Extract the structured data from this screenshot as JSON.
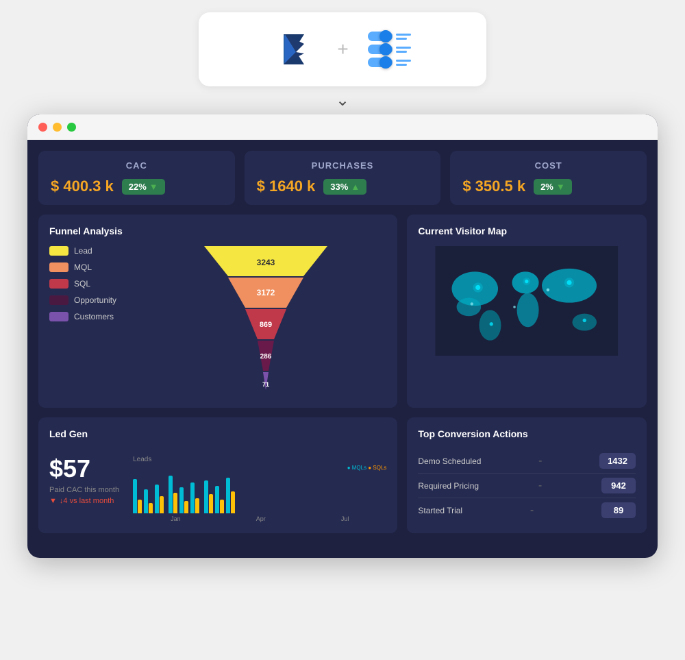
{
  "header": {
    "logo_alt": "Microsoft Dynamics",
    "plus": "+",
    "app_name": "Toggle App"
  },
  "stats": [
    {
      "label": "CAC",
      "value": "$ 400.3 k",
      "badge": "22%",
      "direction": "down",
      "badge_color": "#2e7d4f"
    },
    {
      "label": "PURCHASES",
      "value": "$ 1640 k",
      "badge": "33%",
      "direction": "up",
      "badge_color": "#2e7d4f"
    },
    {
      "label": "COST",
      "value": "$ 350.5 k",
      "badge": "2%",
      "direction": "down",
      "badge_color": "#2e7d4f"
    }
  ],
  "funnel": {
    "title": "Funnel Analysis",
    "legend": [
      {
        "label": "Lead",
        "color": "#f5e642"
      },
      {
        "label": "MQL",
        "color": "#f09060"
      },
      {
        "label": "SQL",
        "color": "#c0394a"
      },
      {
        "label": "Opportunity",
        "color": "#4a1942"
      },
      {
        "label": "Customers",
        "color": "#7b52ab"
      }
    ],
    "values": [
      {
        "label": "3243",
        "pct": 100
      },
      {
        "label": "3172",
        "pct": 82
      },
      {
        "label": "869",
        "pct": 52
      },
      {
        "label": "286",
        "pct": 30
      },
      {
        "label": "71",
        "pct": 14
      }
    ]
  },
  "visitor_map": {
    "title": "Current Visitor Map"
  },
  "led_gen": {
    "title": "Led Gen",
    "value": "$57",
    "subtitle": "Paid CAC this month",
    "change": "▼ ↓4 vs last month",
    "chart_label": "Leads",
    "x_labels": [
      "Jan",
      "Apr",
      "Jul"
    ],
    "bar_legend": [
      "MQLs",
      "SQLs"
    ]
  },
  "conversion": {
    "title": "Top Conversion Actions",
    "items": [
      {
        "label": "Demo Scheduled",
        "dash": "-",
        "value": "1432"
      },
      {
        "label": "Required Pricing",
        "dash": "-",
        "value": "942"
      },
      {
        "label": "Started Trial",
        "dash": "-",
        "value": "89"
      }
    ]
  },
  "window": {
    "dots": [
      "red",
      "yellow",
      "green"
    ]
  }
}
